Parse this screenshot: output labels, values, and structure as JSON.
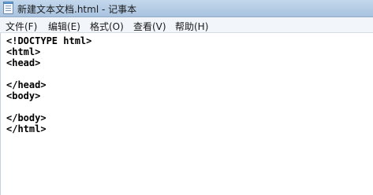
{
  "window": {
    "title": "新建文本文档.html - 记事本",
    "icon": "notepad-icon"
  },
  "menu": {
    "items": [
      "文件(F)",
      "编辑(E)",
      "格式(O)",
      "查看(V)",
      "帮助(H)"
    ]
  },
  "editor": {
    "lines": [
      "<!DOCTYPE html>",
      "<html>",
      "<head>",
      "",
      "</head>",
      "<body>",
      "",
      "</body>",
      "</html>"
    ]
  }
}
